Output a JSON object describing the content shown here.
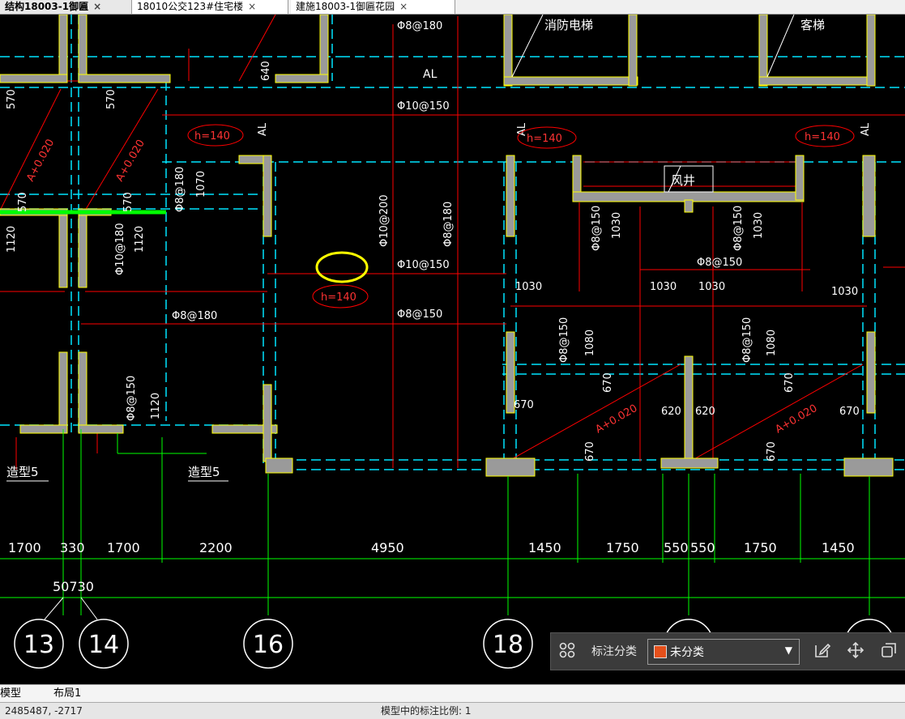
{
  "tabs": [
    {
      "label": "结构18003-1御匾"
    },
    {
      "label": "18010公交123#住宅楼"
    },
    {
      "label": "建施18003-1御匾花园"
    }
  ],
  "tab_close_glyph": "×",
  "drawing": {
    "rebar_labels": [
      "Φ8@180",
      "Φ10@150",
      "Φ10@150",
      "Φ8@150",
      "Φ10@200",
      "Φ8@180",
      "Φ8@180",
      "Φ8@180",
      "Φ10@180",
      "Φ8@150",
      "Φ8@150",
      "Φ8@150",
      "Φ8@150",
      "Φ8@150",
      "Φ8@150"
    ],
    "room_labels": [
      "消防电梯",
      "客梯",
      "风井",
      "AL",
      "AL",
      "AL",
      "AL"
    ],
    "thickness_labels": [
      "h=140",
      "h=140",
      "h=140",
      "h=140"
    ],
    "slope_labels": [
      "A+0.020",
      "A+0.020",
      "A+0.020",
      "A+0.020"
    ],
    "detail_labels": [
      "造型5",
      "造型5"
    ],
    "dim_small": [
      "570",
      "570",
      "570",
      "570",
      "1120",
      "1120",
      "1120",
      "1070",
      "640",
      "1030",
      "1030",
      "1030",
      "1030",
      "1030",
      "1030",
      "1080",
      "1080",
      "670",
      "670",
      "670",
      "670",
      "670",
      "670",
      "620",
      "620"
    ],
    "dim_bottom": [
      "1700",
      "330",
      "1700",
      "2200",
      "4950",
      "1450",
      "1750",
      "550",
      "550",
      "1750",
      "1450"
    ],
    "dim_total": "50730",
    "axis_labels": [
      "13",
      "14",
      "16",
      "18"
    ]
  },
  "toolbar": {
    "grid_icon": "four-squares-icon",
    "label": "标注分类",
    "select_value": "未分类",
    "swatch_color": "#e5501b",
    "caret": "▼",
    "actions": [
      "edit-icon",
      "move-icon",
      "copy-icon"
    ]
  },
  "bottom_tabs": [
    "模型",
    "布局1"
  ],
  "status": {
    "coord": "2485487, -2717",
    "message": "模型中的标注比例: 1"
  },
  "colors": {
    "wall": "#9a9a9a",
    "wall_edge": "#ffff00",
    "rebar": "#ff0000",
    "axis": "#00ff00",
    "dim": "#ff0000",
    "cyan": "#00e5ff",
    "highlight": "#ffff00"
  }
}
